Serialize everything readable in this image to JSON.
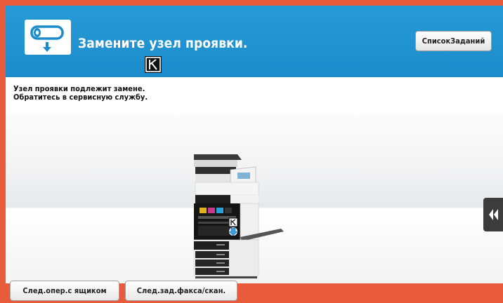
{
  "header": {
    "title": "Замените узел проявки.",
    "icon": "developing-unit-replace-icon",
    "toner_badge": "K",
    "jobs_button_label": "СписокЗаданий"
  },
  "message": {
    "lines": [
      "Узел проявки подлежит замене.",
      "Обратитесь в сервисную службу."
    ]
  },
  "illustration": {
    "device_icon": "printer-open-front-icon",
    "badge_label": "K",
    "side_tab_icon": "double-chevron-left-icon"
  },
  "footer": {
    "buttons": [
      "След.опер.с ящиком",
      "След.зад.факса/скан."
    ]
  },
  "colors": {
    "frame": "#e85c3c",
    "header": "#1e90cf",
    "message_bg": "#ffffff"
  }
}
